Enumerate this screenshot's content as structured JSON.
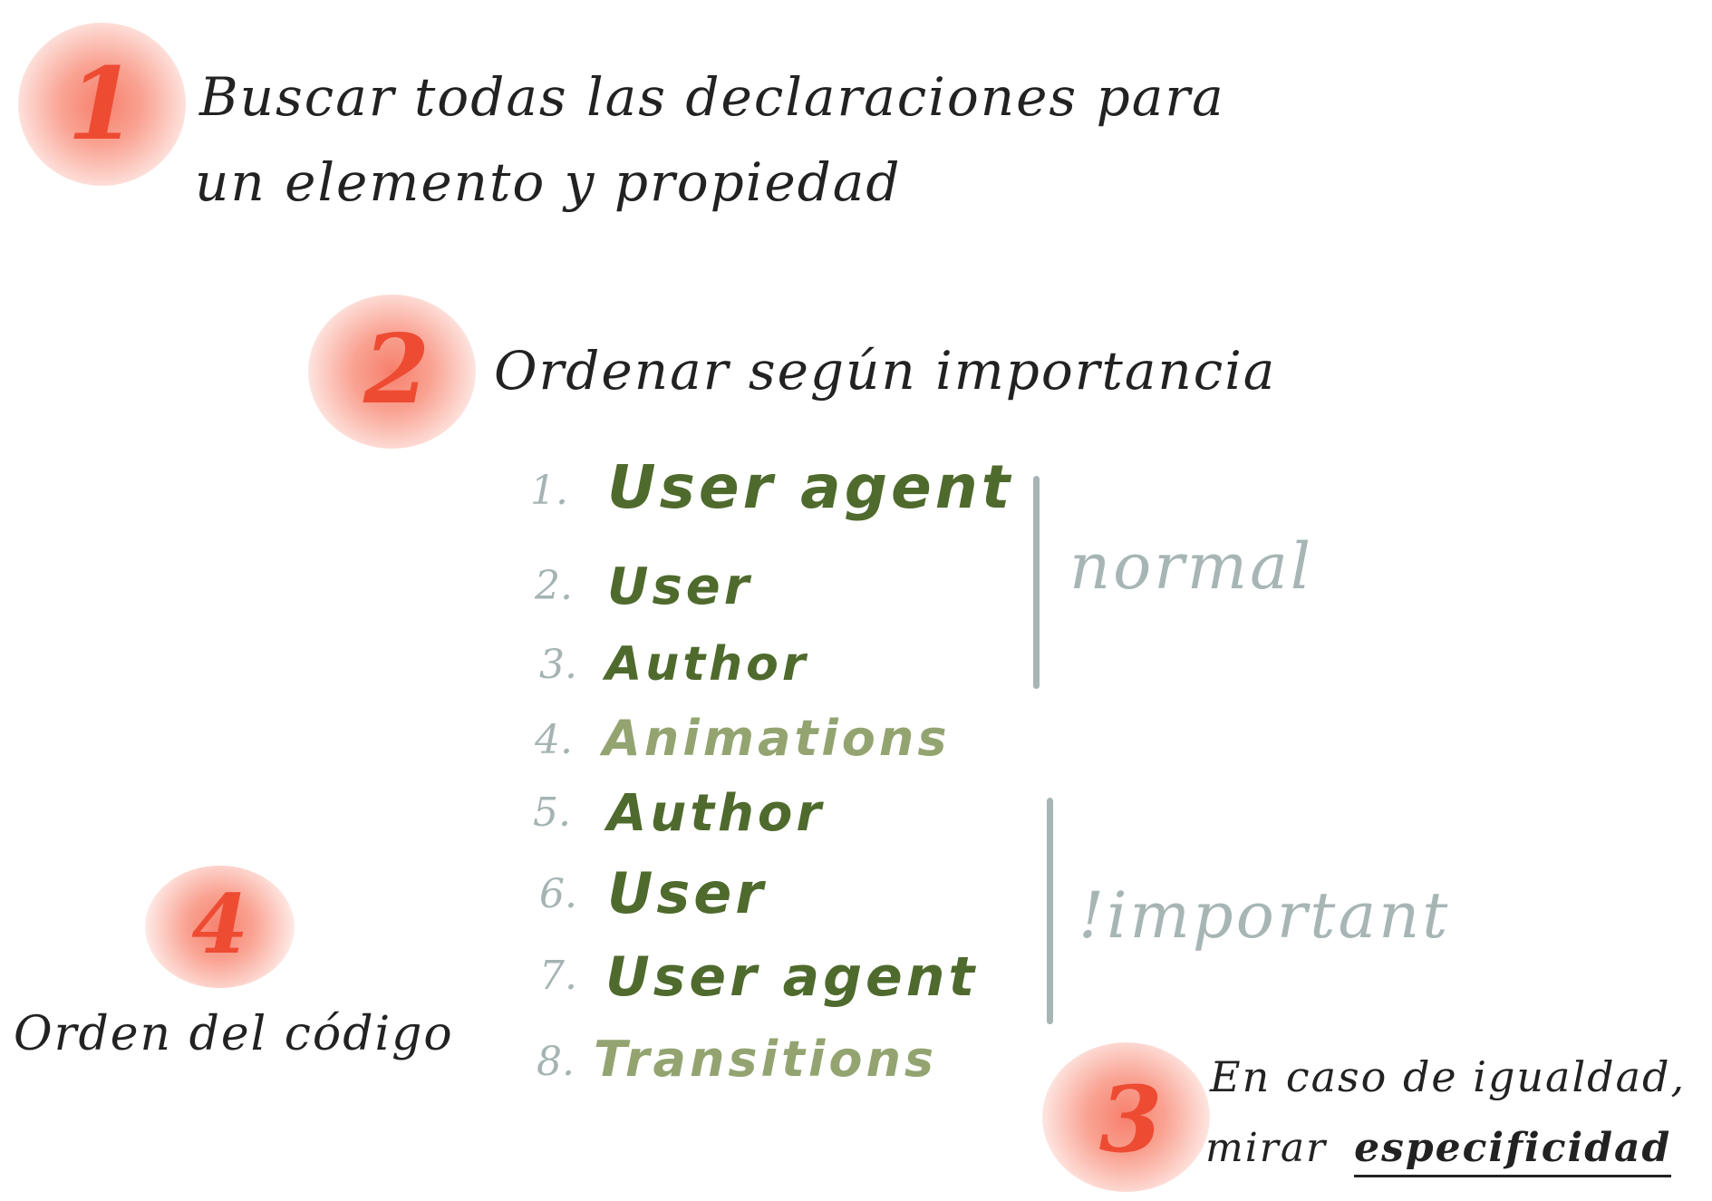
{
  "colors": {
    "step_number": "#ee4b33",
    "blob": "#f6785f",
    "text": "#222222",
    "list_number": "#a5b4b3",
    "origin_dark": "#4f6a2d",
    "origin_light": "#93a471",
    "group_label": "#a7b6b5"
  },
  "steps": [
    {
      "number": "1",
      "lines": [
        "Buscar todas las declaraciones para",
        "un elemento y propiedad"
      ]
    },
    {
      "number": "2",
      "lines": [
        "Ordenar según importancia"
      ]
    },
    {
      "number": "3",
      "line1": "En caso de igualdad,",
      "line2_prefix": "mirar",
      "line2_emphasis": "especificidad"
    },
    {
      "number": "4",
      "lines": [
        "Orden del código"
      ]
    }
  ],
  "importance_list": [
    {
      "index": "1.",
      "label": "User agent",
      "shade": "dark"
    },
    {
      "index": "2.",
      "label": "User",
      "shade": "dark"
    },
    {
      "index": "3.",
      "label": "Author",
      "shade": "dark"
    },
    {
      "index": "4.",
      "label": "Animations",
      "shade": "light"
    },
    {
      "index": "5.",
      "label": "Author",
      "shade": "dark"
    },
    {
      "index": "6.",
      "label": "User",
      "shade": "dark"
    },
    {
      "index": "7.",
      "label": "User agent",
      "shade": "dark"
    },
    {
      "index": "8.",
      "label": "Transitions",
      "shade": "light"
    }
  ],
  "groups": {
    "normal": "normal",
    "important": "!important"
  }
}
